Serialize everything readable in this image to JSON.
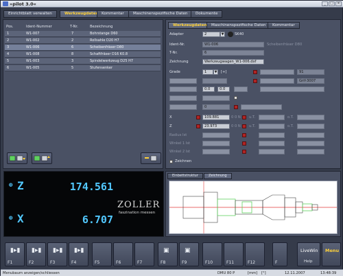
{
  "window": {
    "title": "»pilot 3.0«"
  },
  "main_tabs": [
    {
      "label": "Einrichtblatt verwalten",
      "active": false
    },
    {
      "label": "Werkzeugdaten",
      "active": true
    },
    {
      "label": "Kommentar",
      "active": false
    },
    {
      "label": "Maschinenspezifische Daten",
      "active": false
    },
    {
      "label": "Dokumente",
      "active": false
    }
  ],
  "tool_table": {
    "headers": [
      "Pos.",
      "Ident-Nummer",
      "T-Nr.",
      "Bezeichnung"
    ],
    "rows": [
      {
        "pos": "1",
        "ident": "W1-007",
        "tnr": "7",
        "name": "Bohrstange D60",
        "selected": false
      },
      {
        "pos": "2",
        "ident": "W1-002",
        "tnr": "2",
        "name": "Rollsahle D20 H7",
        "selected": false
      },
      {
        "pos": "3",
        "ident": "W1-006",
        "tnr": "6",
        "name": "Scheibenfräser D80",
        "selected": true
      },
      {
        "pos": "4",
        "ident": "W1-008",
        "tnr": "8",
        "name": "Schaftfräser D16 K0.8",
        "selected": false
      },
      {
        "pos": "5",
        "ident": "W1-003",
        "tnr": "3",
        "name": "Spindelwerkzeug D25 H7",
        "selected": false
      },
      {
        "pos": "6",
        "ident": "W1-005",
        "tnr": "5",
        "name": "Stufensenker",
        "selected": false
      }
    ]
  },
  "sub_tabs": [
    {
      "label": "Werkzeugdaten",
      "active": true
    },
    {
      "label": "Maschinenspezifische Daten",
      "active": false
    },
    {
      "label": "Kommentar",
      "active": false
    }
  ],
  "form": {
    "adapter_label": "Adapter",
    "adapter_value": "2",
    "adapter_badge": "SK40",
    "ident_label": "Ident-Nr.",
    "ident_value": "W1-006",
    "ident_note": "Scheibenfräser D80",
    "tnr_label": "T-Nr.",
    "tnr_value": "6",
    "zeichnung_label": "Zeichnung",
    "zeichnung_value": "Werkzeugwagen_W1-006.dxf",
    "grade_label": "Grade",
    "grade_value": "1",
    "grade_unit": "[+]",
    "right1_value": "91",
    "right2_value": "Grif-3007",
    "left_small_1": "0.0",
    "left_small_2": "0.0",
    "mid_value": "0",
    "x_label": "X",
    "x_value": "109.881",
    "x_suffix": "0 0 N",
    "x_ut": "u.T.",
    "x_ot": "o.T.",
    "z_label": "Z",
    "z_value": "23.973",
    "z_suffix": "0 0 N",
    "z_ut": "u.T.",
    "z_ot": "o.T.",
    "radius_label": "Radius Ist",
    "winkel1_label": "Winkel 1 Ist",
    "winkel2_label": "Winkel 2 Ist",
    "checkbox_label": "Zeichnen"
  },
  "drawing_tabs": [
    {
      "label": "Einbettstruktur",
      "active": false
    },
    {
      "label": "Zeichnung",
      "active": true
    }
  ],
  "dro": {
    "z_axis": "Z",
    "z_value": "174.561",
    "x_axis": "X",
    "x_value": "6.707",
    "brand": "ZOLLER",
    "tagline": "faszination messen"
  },
  "fkeys": [
    {
      "label": "F1",
      "glyph": "▮▸▮"
    },
    {
      "label": "F2",
      "glyph": "▮▸▮"
    },
    {
      "label": "F3",
      "glyph": "▮▸▮"
    },
    {
      "label": "F4",
      "glyph": "▮▸▮"
    },
    {
      "label": "F5",
      "glyph": ""
    },
    {
      "label": "F6",
      "glyph": ""
    },
    {
      "label": "F7",
      "glyph": ""
    },
    {
      "label": "F8",
      "glyph": "▣"
    },
    {
      "label": "F9",
      "glyph": "▣"
    },
    {
      "label": "F10",
      "glyph": ""
    },
    {
      "label": "F11",
      "glyph": ""
    },
    {
      "label": "F12",
      "glyph": ""
    }
  ],
  "right_keys": {
    "livewin": "LiveWin",
    "help": "Help",
    "menu": "Menu",
    "f_extra": "F"
  },
  "status": {
    "left": "Menubaum anzeigen/schliessen",
    "machine": "DMU 80 P",
    "unit": "[mm]",
    "angle": "[°]",
    "date": "12.11.2007",
    "time": "13:48:39"
  },
  "colors": {
    "accent": "#ffd23a",
    "dro": "#52c8ff",
    "panel": "#4a5164",
    "tool_highlight": "#5fd25f",
    "axis_red": "#e23a3a"
  }
}
